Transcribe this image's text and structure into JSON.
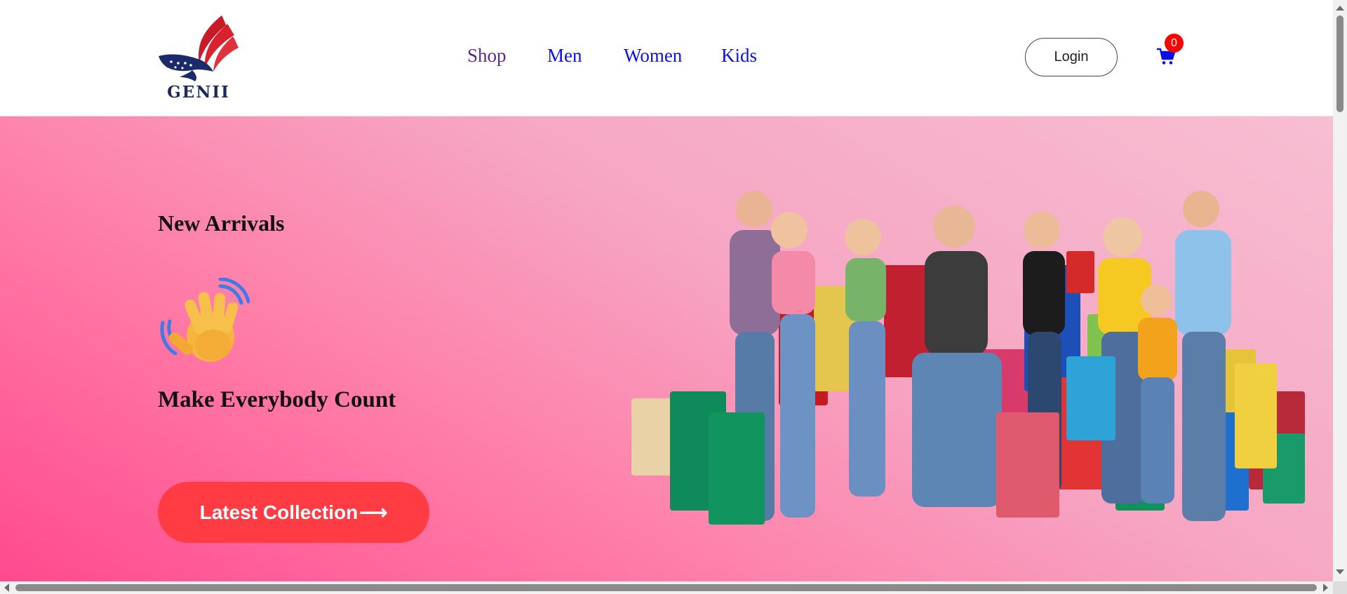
{
  "header": {
    "logo": {
      "text": "GENII",
      "icon": "eagle-logo"
    },
    "nav": [
      {
        "label": "Shop",
        "state": "visited"
      },
      {
        "label": "Men"
      },
      {
        "label": "Women"
      },
      {
        "label": "Kids"
      }
    ],
    "login_label": "Login",
    "cart": {
      "icon": "shopping-cart-icon",
      "count": "0"
    }
  },
  "hero": {
    "kicker": "New Arrivals",
    "wave_icon": "waving-hand-icon",
    "title": "Make Everybody Count",
    "cta_label": "Latest Collection",
    "cta_arrow": "⟶",
    "image": "group-of-shoppers-with-bags-image"
  },
  "colors": {
    "nav_link": "#0a10e6",
    "nav_visited": "#5b2a8c",
    "cta_bg": "#ff3b44",
    "badge_bg": "#ff0000",
    "hero_gradient_start": "#ff4a8d",
    "hero_gradient_end": "#f7bed2"
  }
}
